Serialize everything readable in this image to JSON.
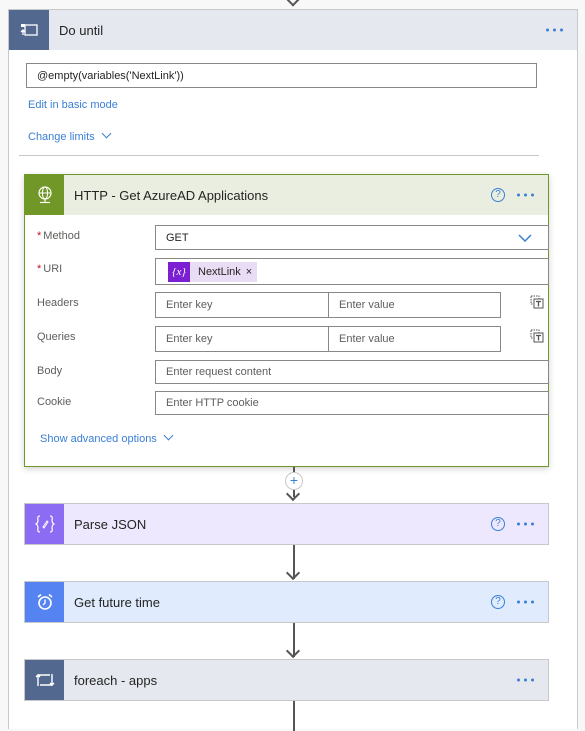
{
  "do_until": {
    "title": "Do until",
    "icon": "do-until-icon",
    "expression": "@empty(variables('NextLink'))",
    "edit_basic_label": "Edit in basic mode",
    "change_limits_label": "Change limits"
  },
  "http_action": {
    "title": "HTTP - Get AzureAD Applications",
    "icon": "globe-icon",
    "help": "?",
    "fields": {
      "method_label": "Method",
      "method_value": "GET",
      "uri_label": "URI",
      "uri_token": "NextLink",
      "uri_token_icon": "{x}",
      "uri_token_remove": "×",
      "headers_label": "Headers",
      "headers_key_placeholder": "Enter key",
      "headers_value_placeholder": "Enter value",
      "queries_label": "Queries",
      "queries_key_placeholder": "Enter key",
      "queries_value_placeholder": "Enter value",
      "body_label": "Body",
      "body_placeholder": "Enter request content",
      "cookie_label": "Cookie",
      "cookie_placeholder": "Enter HTTP cookie"
    },
    "required_marker": "*",
    "show_advanced_label": "Show advanced options"
  },
  "add_step": "+",
  "parse_json": {
    "title": "Parse JSON",
    "icon": "parse-json-icon",
    "help": "?"
  },
  "future_time": {
    "title": "Get future time",
    "icon": "alarm-clock-icon",
    "help": "?"
  },
  "foreach": {
    "title": "foreach - apps",
    "icon": "loop-icon"
  },
  "colors": {
    "loop_blue": "#53688f",
    "http_green": "#709727",
    "parse_purple": "#8c6cf2",
    "time_blue": "#5583f2",
    "link_blue": "#3a7fd5"
  }
}
